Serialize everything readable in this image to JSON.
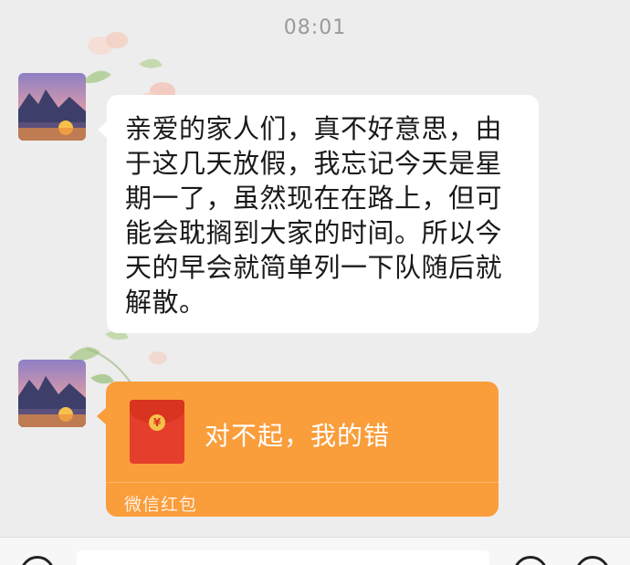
{
  "status": {
    "time": "08:01"
  },
  "messages": [
    {
      "type": "text",
      "text": "亲爱的家人们，真不好意思，由于这几天放假，我忘记今天是星期一了，虽然现在在路上，但可能会耽搁到大家的时间。所以今天的早会就简单列一下队随后就解散。",
      "lines": [
        "亲爱的家人们，真不好意思，由",
        "于这几天放假，我忘记今天是星",
        "期一了，虽然现在在路上，但可",
        "能会耽搁到大家的时间。所以今",
        "天的早会就简单列一下队随后就",
        "解散。"
      ]
    },
    {
      "type": "red_packet",
      "title": "对不起，我的错",
      "footer": "微信红包",
      "coin_symbol": "¥"
    }
  ],
  "icons": {
    "avatar": "landscape-avatar",
    "red_packet": "red-envelope-icon",
    "voice": "voice-icon",
    "emoji": "emoji-icon",
    "more": "plus-icon"
  },
  "colors": {
    "background": "#ededed",
    "bubble": "#ffffff",
    "red_packet_bg": "#fa9d3b",
    "red_envelope": "#e53e2c"
  }
}
